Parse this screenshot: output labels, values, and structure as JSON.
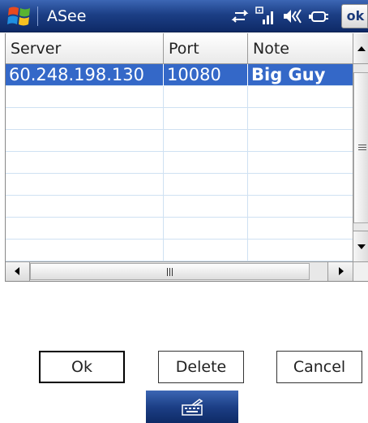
{
  "window": {
    "title": "ASee",
    "ok_label": "ok"
  },
  "status_icons": [
    "connectivity-icon",
    "signal-icon",
    "volume-icon",
    "battery-icon"
  ],
  "listview": {
    "columns": [
      "Server",
      "Port",
      "Note"
    ],
    "rows": [
      {
        "server": "60.248.198.130",
        "port": "10080",
        "note": "Big Guy",
        "selected": true
      },
      {
        "server": "",
        "port": "",
        "note": ""
      },
      {
        "server": "",
        "port": "",
        "note": ""
      },
      {
        "server": "",
        "port": "",
        "note": ""
      },
      {
        "server": "",
        "port": "",
        "note": ""
      },
      {
        "server": "",
        "port": "",
        "note": ""
      },
      {
        "server": "",
        "port": "",
        "note": ""
      },
      {
        "server": "",
        "port": "",
        "note": ""
      },
      {
        "server": "",
        "port": "",
        "note": ""
      }
    ]
  },
  "buttons": {
    "ok": "Ok",
    "delete": "Delete",
    "cancel": "Cancel"
  },
  "menubar": {
    "icon": "keyboard-icon"
  },
  "colors": {
    "titlebar": "#1c3f86",
    "selection": "#3468c8"
  }
}
